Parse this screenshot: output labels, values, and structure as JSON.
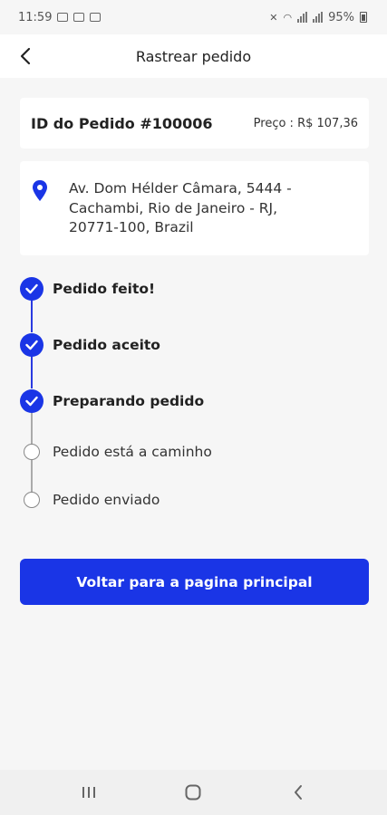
{
  "status_bar": {
    "time": "11:59",
    "battery": "95%"
  },
  "header": {
    "title": "Rastrear pedido",
    "back_icon": "chevron-left-icon"
  },
  "order": {
    "id_label": "ID do Pedido #100006",
    "price_label": "Preço : R$ 107,36"
  },
  "address": {
    "icon": "location-pin-icon",
    "line1": "Av. Dom Hélder Câmara, 5444 -",
    "line2": "Cachambi, Rio de Janeiro - RJ,",
    "line3": "20771-100, Brazil"
  },
  "timeline": {
    "steps": [
      {
        "label": "Pedido feito!",
        "done": true
      },
      {
        "label": "Pedido aceito",
        "done": true
      },
      {
        "label": "Preparando pedido",
        "done": true
      },
      {
        "label": "Pedido está a caminho",
        "done": false
      },
      {
        "label": "Pedido enviado",
        "done": false
      }
    ],
    "accent_color": "#1a35e6"
  },
  "actions": {
    "home_button": "Voltar para a pagina principal"
  },
  "nav_bar": {
    "recent_icon": "recent-apps-icon",
    "home_icon": "home-icon",
    "back_icon": "back-icon"
  }
}
